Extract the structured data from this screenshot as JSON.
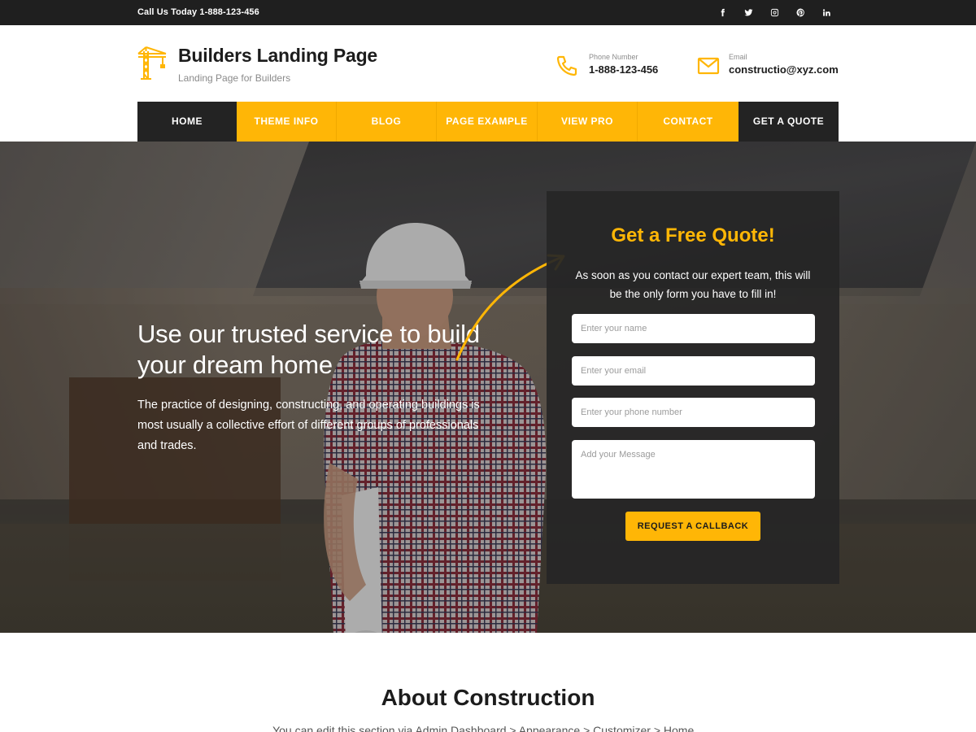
{
  "topbar": {
    "call_text": "Call Us Today  1-888-123-456",
    "socials": [
      {
        "name": "facebook-icon",
        "glyph": "f"
      },
      {
        "name": "twitter-icon",
        "glyph": "t"
      },
      {
        "name": "instagram-icon",
        "glyph": "i"
      },
      {
        "name": "pinterest-icon",
        "glyph": "p"
      },
      {
        "name": "linkedin-icon",
        "glyph": "in"
      }
    ]
  },
  "header": {
    "site_title": "Builders Landing Page",
    "tagline": "Landing Page for Builders",
    "phone_label": "Phone Number",
    "phone_value": "1-888-123-456",
    "email_label": "Email",
    "email_value": "constructio@xyz.com"
  },
  "nav": {
    "items": [
      "HOME",
      "THEME INFO",
      "BLOG",
      "PAGE EXAMPLE",
      "VIEW PRO",
      "CONTACT",
      "GET A QUOTE"
    ]
  },
  "hero": {
    "title": "Use our trusted service to build your dream home",
    "text": "The practice of designing, constructing, and operating buildings is most usually a collective effort of different groups of professionals and trades."
  },
  "quote_form": {
    "title": "Get a Free Quote!",
    "subtitle": "As soon as you contact our expert team, this will be the only form you have to fill in!",
    "name_placeholder": "Enter your name",
    "email_placeholder": "Enter your email",
    "phone_placeholder": "Enter your phone number",
    "message_placeholder": "Add your Message",
    "submit_label": "REQUEST A CALLBACK"
  },
  "about": {
    "title": "About Construction",
    "text": "You can edit this section via Admin Dashboard > Appearance > Customizer > Home..."
  },
  "colors": {
    "accent": "#ffb606",
    "dark": "#232323",
    "topbar": "#1f1f1f"
  }
}
